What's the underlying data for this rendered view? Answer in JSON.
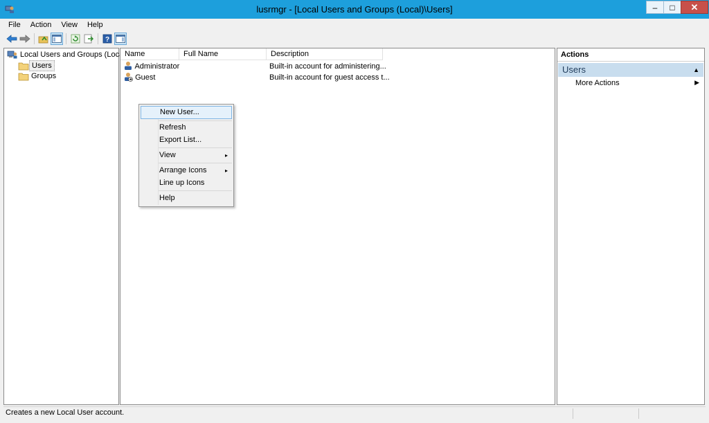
{
  "window": {
    "title": "lusrmgr - [Local Users and Groups (Local)\\Users]",
    "controls": {
      "minimize": "–",
      "maximize": "□",
      "close": "✕"
    }
  },
  "menubar": [
    "File",
    "Action",
    "View",
    "Help"
  ],
  "toolbar": {
    "buttons": [
      "back-icon",
      "forward-icon",
      "up-folder-icon",
      "show-hide-console-tree-icon",
      "refresh-icon",
      "export-list-icon",
      "help-icon",
      "show-hide-action-pane-icon"
    ]
  },
  "tree": {
    "root": "Local Users and Groups (Local)",
    "items": [
      "Users",
      "Groups"
    ],
    "selected": "Users"
  },
  "list": {
    "columns": [
      "Name",
      "Full Name",
      "Description"
    ],
    "rows": [
      {
        "name": "Administrator",
        "full_name": "",
        "description": "Built-in account for administering..."
      },
      {
        "name": "Guest",
        "full_name": "",
        "description": "Built-in account for guest access t..."
      }
    ]
  },
  "context_menu": {
    "items": [
      "New User...",
      "Refresh",
      "Export List...",
      "View",
      "Arrange Icons",
      "Line up Icons",
      "Help"
    ],
    "submenu_arrow": "▸",
    "highlighted": "New User..."
  },
  "actions": {
    "title": "Actions",
    "section": "Users",
    "collapse_glyph": "▲",
    "items": [
      "More Actions"
    ],
    "arrow_glyph": "▶"
  },
  "status": {
    "text": "Creates a new Local User account."
  },
  "colors": {
    "frame": "#1d9fdc",
    "selection_highlight": "#e5f1fb",
    "actions_header": "#c8ddee",
    "close_button": "#c7504a"
  }
}
